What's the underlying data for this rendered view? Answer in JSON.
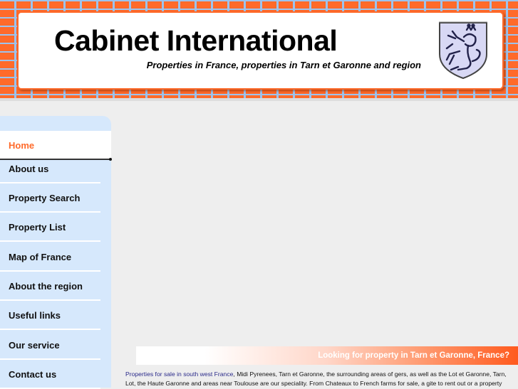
{
  "header": {
    "title": "Cabinet International",
    "tagline": "Properties in France, properties in Tarn et Garonne and region",
    "crest_icon": "heraldic-lion-shield-icon",
    "colors": {
      "brick": "#ff6a2a",
      "mortar": "#9cc3ee"
    }
  },
  "sidebar": {
    "items": [
      {
        "label": "Home",
        "active": true
      },
      {
        "label": "About us"
      },
      {
        "label": "Property Search"
      },
      {
        "label": "Property List"
      },
      {
        "label": "Map of France"
      },
      {
        "label": "About the region"
      },
      {
        "label": "Useful links"
      },
      {
        "label": "Our service"
      },
      {
        "label": "Contact us"
      }
    ],
    "colors": {
      "background": "#d6e8fc",
      "active_text": "#ff6a2a"
    }
  },
  "main": {
    "banner_text": "Looking for property in Tarn et Garonne, France?",
    "intro_link": "Properties for sale in south west France",
    "intro_text": ", Midi Pyrenees, Tarn et Garonne,  the surrounding areas of gers, as well as the Lot et Garonne, Tarn, Lot, the Haute Garonne and areas near Toulouse are our speciality. From Chateaux to French farms for sale, a gite to rent out or a property"
  }
}
